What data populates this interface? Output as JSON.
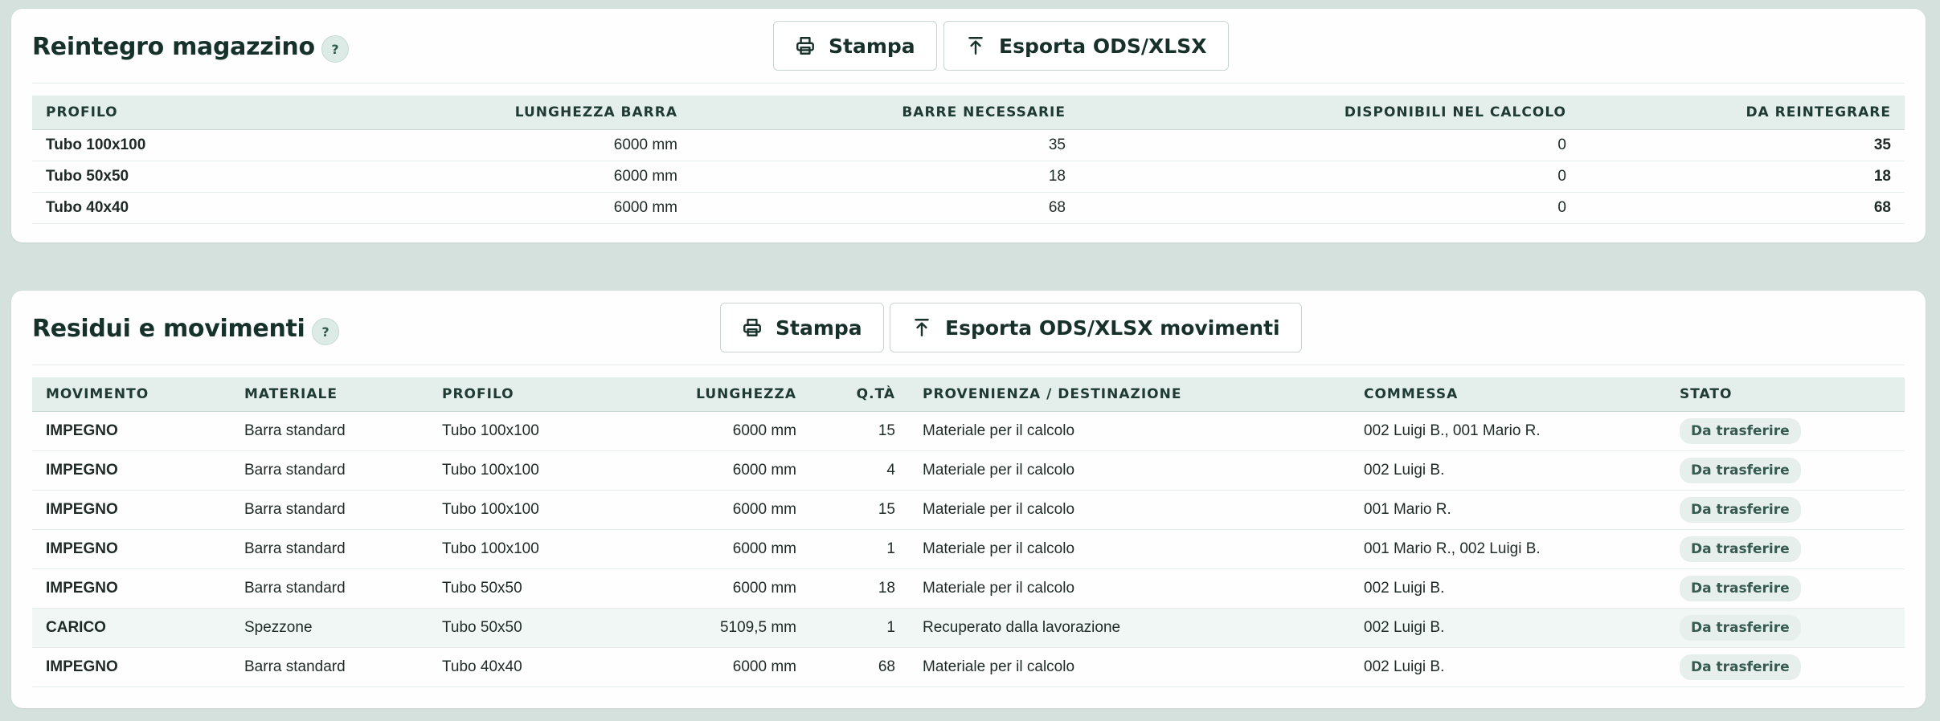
{
  "reintegro": {
    "title": "Reintegro magazzino",
    "help": "?",
    "print_label": "Stampa",
    "export_label": "Esporta ODS/XLSX",
    "columns": [
      "PROFILO",
      "LUNGHEZZA BARRA",
      "BARRE NECESSARIE",
      "DISPONIBILI NEL CALCOLO",
      "DA REINTEGRARE"
    ],
    "rows": [
      {
        "profilo": "Tubo 100x100",
        "lunghezza": "6000 mm",
        "necessarie": "35",
        "disponibili": "0",
        "reintegrare": "35"
      },
      {
        "profilo": "Tubo 50x50",
        "lunghezza": "6000 mm",
        "necessarie": "18",
        "disponibili": "0",
        "reintegrare": "18"
      },
      {
        "profilo": "Tubo 40x40",
        "lunghezza": "6000 mm",
        "necessarie": "68",
        "disponibili": "0",
        "reintegrare": "68"
      }
    ]
  },
  "residui": {
    "title": "Residui e movimenti",
    "help": "?",
    "print_label": "Stampa",
    "export_label": "Esporta ODS/XLSX movimenti",
    "columns": [
      "MOVIMENTO",
      "MATERIALE",
      "PROFILO",
      "LUNGHEZZA",
      "Q.TÀ",
      "PROVENIENZA / DESTINAZIONE",
      "COMMESSA",
      "STATO"
    ],
    "rows": [
      {
        "movimento": "IMPEGNO",
        "materiale": "Barra standard",
        "profilo": "Tubo 100x100",
        "lunghezza": "6000 mm",
        "qta": "15",
        "provenienza": "Materiale per il calcolo",
        "commessa": "002 Luigi B., 001 Mario R.",
        "stato": "Da trasferire"
      },
      {
        "movimento": "IMPEGNO",
        "materiale": "Barra standard",
        "profilo": "Tubo 100x100",
        "lunghezza": "6000 mm",
        "qta": "4",
        "provenienza": "Materiale per il calcolo",
        "commessa": "002 Luigi B.",
        "stato": "Da trasferire"
      },
      {
        "movimento": "IMPEGNO",
        "materiale": "Barra standard",
        "profilo": "Tubo 100x100",
        "lunghezza": "6000 mm",
        "qta": "15",
        "provenienza": "Materiale per il calcolo",
        "commessa": "001 Mario R.",
        "stato": "Da trasferire"
      },
      {
        "movimento": "IMPEGNO",
        "materiale": "Barra standard",
        "profilo": "Tubo 100x100",
        "lunghezza": "6000 mm",
        "qta": "1",
        "provenienza": "Materiale per il calcolo",
        "commessa": "001 Mario R., 002 Luigi B.",
        "stato": "Da trasferire"
      },
      {
        "movimento": "IMPEGNO",
        "materiale": "Barra standard",
        "profilo": "Tubo 50x50",
        "lunghezza": "6000 mm",
        "qta": "18",
        "provenienza": "Materiale per il calcolo",
        "commessa": "002 Luigi B.",
        "stato": "Da trasferire"
      },
      {
        "movimento": "CARICO",
        "materiale": "Spezzone",
        "profilo": "Tubo 50x50",
        "lunghezza": "5109,5 mm",
        "qta": "1",
        "provenienza": "Recuperato dalla lavorazione",
        "commessa": "002 Luigi B.",
        "stato": "Da trasferire"
      },
      {
        "movimento": "IMPEGNO",
        "materiale": "Barra standard",
        "profilo": "Tubo 40x40",
        "lunghezza": "6000 mm",
        "qta": "68",
        "provenienza": "Materiale per il calcolo",
        "commessa": "002 Luigi B.",
        "stato": "Da trasferire"
      }
    ]
  },
  "icons": {
    "print": "printer-icon",
    "export": "upload-icon"
  }
}
